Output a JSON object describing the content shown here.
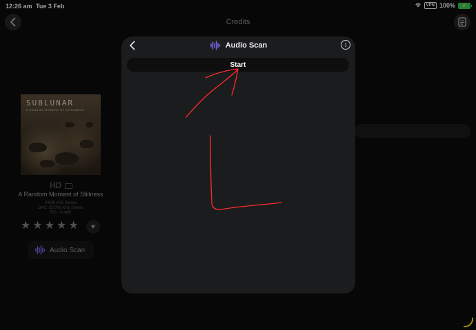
{
  "status_bar": {
    "time": "12:26 am",
    "date": "Tue 3 Feb",
    "vpn": "VPN",
    "battery_percent": "100%",
    "battery_level": 1.0
  },
  "background_page": {
    "title": "Credits",
    "back_icon": "chevron-left-icon",
    "menu_icon": "document-icon",
    "album": {
      "art_title": "SUBLUNAR",
      "art_subtitle": "A RANDOM MOMENT OF STILLNESS",
      "hd_badge": "HD",
      "name": "A Random Moment of Stillness",
      "format": "24/96 kHz Stereo",
      "dac": "DAC: 32/768 kHz Stereo",
      "rg": "RG: -9.4dB",
      "rating": 5,
      "max_rating": 5,
      "heart_icon": "heart-icon"
    },
    "audio_scan_button_label": "Audio Scan"
  },
  "modal": {
    "title": "Audio Scan",
    "title_icon": "waveform-icon",
    "back_icon": "chevron-left-icon",
    "info_icon": "info-icon",
    "info_glyph": "i",
    "start_button_label": "Start"
  },
  "colors": {
    "accent": "#7b6cf6",
    "annotation": "#ff2d2d",
    "battery": "#34c759"
  }
}
